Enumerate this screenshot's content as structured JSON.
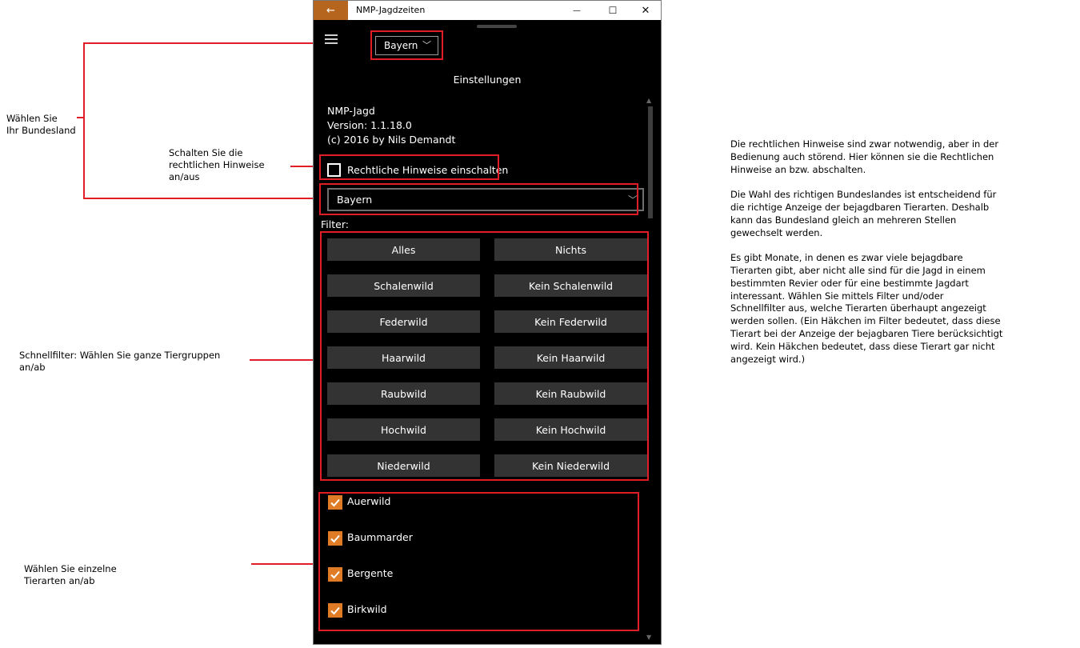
{
  "annotations": {
    "bundesland_line1": "Wählen Sie",
    "bundesland_line2": "Ihr Bundesland",
    "hinweise_line1": "Schalten Sie die",
    "hinweise_line2": "rechtlichen Hinweise",
    "hinweise_line3": "an/aus",
    "schnellfilter_line1": "Schnellfilter: Wählen Sie ganze Tiergruppen",
    "schnellfilter_line2": "an/ab",
    "tierarten_line1": "Wählen Sie einzelne",
    "tierarten_line2": "Tierarten an/ab",
    "right": [
      "Die rechtlichen Hinweise sind zwar notwendig, aber in der",
      "Bedienung auch störend. Hier können sie die Rechtlichen",
      "Hinweise an bzw. abschalten.",
      "",
      "Die Wahl des richtigen Bundeslandes ist entscheidend für",
      "die richtige Anzeige der bejagdbaren Tierarten. Deshalb",
      "kann das Bundesland gleich an mehreren Stellen",
      "gewechselt werden.",
      "",
      "Es gibt Monate, in denen es zwar viele bejagdbare",
      "Tierarten gibt, aber nicht alle sind für die Jagd in einem",
      "bestimmten Revier oder für eine bestimmte Jagdart",
      "interessant. Wählen Sie mittels Filter und/oder",
      "Schnellfilter aus, welche Tierarten überhaupt angezeigt",
      "werden sollen. (Ein Häkchen im Filter bedeutet, dass diese",
      "Tierart bei der Anzeige der bejagbaren Tiere berücksichtigt",
      "wird. Kein Häkchen bedeutet, dass diese Tierart gar nicht",
      "angezeigt wird.)"
    ]
  },
  "window": {
    "title": "NMP-Jagdzeiten",
    "back_icon": "←",
    "minimize_icon": "—",
    "maximize_icon": "☐",
    "close_icon": "✕"
  },
  "app": {
    "top_select": "Bayern",
    "section_title": "Einstellungen",
    "app_name": "NMP-Jagd",
    "version": "Version: 1.1.18.0",
    "copyright": "(c) 2016 by Nils Demandt",
    "legal_checkbox_label": "Rechtliche Hinweise einschalten",
    "legal_checked": false,
    "main_select": "Bayern",
    "filter_label": "Filter:",
    "filter_buttons": [
      [
        "Alles",
        "Nichts"
      ],
      [
        "Schalenwild",
        "Kein Schalenwild"
      ],
      [
        "Federwild",
        "Kein Federwild"
      ],
      [
        "Haarwild",
        "Kein Haarwild"
      ],
      [
        "Raubwild",
        "Kein Raubwild"
      ],
      [
        "Hochwild",
        "Kein Hochwild"
      ],
      [
        "Niederwild",
        "Kein Niederwild"
      ]
    ],
    "species": [
      {
        "label": "Auerwild",
        "checked": true
      },
      {
        "label": "Baummarder",
        "checked": true
      },
      {
        "label": "Bergente",
        "checked": true
      },
      {
        "label": "Birkwild",
        "checked": true
      }
    ],
    "accent_color": "#e07c26",
    "titlebar_accent": "#b5651d"
  }
}
